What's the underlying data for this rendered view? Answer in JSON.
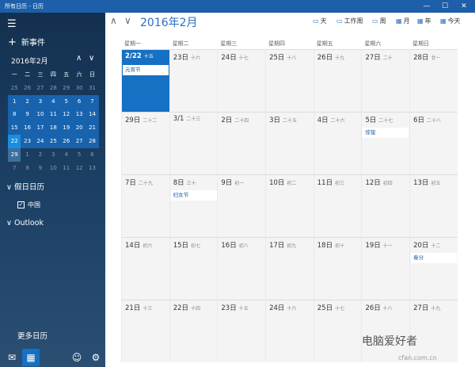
{
  "window": {
    "title": "所有日历 - 日历",
    "controls": [
      "—",
      "☐",
      "✕"
    ]
  },
  "sidebar": {
    "menu_icon": "☰",
    "new_event": "新事件",
    "mini_month": "2016年2月",
    "weekdays": [
      "一",
      "二",
      "三",
      "四",
      "五",
      "六",
      "日"
    ],
    "weeks": [
      [
        {
          "d": "25",
          "t": "o"
        },
        {
          "d": "26",
          "t": "o"
        },
        {
          "d": "27",
          "t": "o"
        },
        {
          "d": "28",
          "t": "o"
        },
        {
          "d": "29",
          "t": "o"
        },
        {
          "d": "30",
          "t": "o"
        },
        {
          "d": "31",
          "t": "o"
        }
      ],
      [
        {
          "d": "1",
          "t": "c"
        },
        {
          "d": "2",
          "t": "c"
        },
        {
          "d": "3",
          "t": "c"
        },
        {
          "d": "4",
          "t": "c"
        },
        {
          "d": "5",
          "t": "c"
        },
        {
          "d": "6",
          "t": "c"
        },
        {
          "d": "7",
          "t": "c"
        }
      ],
      [
        {
          "d": "8",
          "t": "c"
        },
        {
          "d": "9",
          "t": "c"
        },
        {
          "d": "10",
          "t": "c"
        },
        {
          "d": "11",
          "t": "c"
        },
        {
          "d": "12",
          "t": "c"
        },
        {
          "d": "13",
          "t": "c"
        },
        {
          "d": "14",
          "t": "c"
        }
      ],
      [
        {
          "d": "15",
          "t": "c"
        },
        {
          "d": "16",
          "t": "c"
        },
        {
          "d": "17",
          "t": "c"
        },
        {
          "d": "18",
          "t": "c"
        },
        {
          "d": "19",
          "t": "c"
        },
        {
          "d": "20",
          "t": "c"
        },
        {
          "d": "21",
          "t": "c"
        }
      ],
      [
        {
          "d": "22",
          "t": "today"
        },
        {
          "d": "23",
          "t": "c"
        },
        {
          "d": "24",
          "t": "c"
        },
        {
          "d": "25",
          "t": "c"
        },
        {
          "d": "26",
          "t": "c"
        },
        {
          "d": "27",
          "t": "c"
        },
        {
          "d": "28",
          "t": "c"
        }
      ],
      [
        {
          "d": "29",
          "t": "sel"
        },
        {
          "d": "1",
          "t": "o"
        },
        {
          "d": "2",
          "t": "o"
        },
        {
          "d": "3",
          "t": "o"
        },
        {
          "d": "4",
          "t": "o"
        },
        {
          "d": "5",
          "t": "o"
        },
        {
          "d": "6",
          "t": "o"
        }
      ],
      [
        {
          "d": "7",
          "t": "o"
        },
        {
          "d": "8",
          "t": "o"
        },
        {
          "d": "9",
          "t": "o"
        },
        {
          "d": "10",
          "t": "o"
        },
        {
          "d": "11",
          "t": "o"
        },
        {
          "d": "12",
          "t": "o"
        },
        {
          "d": "13",
          "t": "o"
        }
      ]
    ],
    "holiday_section": "假日日历",
    "holiday_item": "中国",
    "outlook_section": "Outlook",
    "more_calendars": "更多日历"
  },
  "toolbar": {
    "title": "2016年2月",
    "views": [
      {
        "icon": "▭",
        "label": "天"
      },
      {
        "icon": "▭",
        "label": "工作周"
      },
      {
        "icon": "▭",
        "label": "周"
      },
      {
        "icon": "▦",
        "label": "月"
      },
      {
        "icon": "▦",
        "label": "年"
      },
      {
        "icon": "▦",
        "label": "今天"
      }
    ]
  },
  "calendar": {
    "day_headers": [
      "星期一",
      "星期二",
      "星期三",
      "星期四",
      "星期五",
      "星期六",
      "星期日"
    ],
    "weeks": [
      [
        {
          "date": "2/22",
          "lunar": "十五",
          "event": "元宵节",
          "selected": true
        },
        {
          "date": "23日",
          "lunar": "十六"
        },
        {
          "date": "24日",
          "lunar": "十七"
        },
        {
          "date": "25日",
          "lunar": "十八"
        },
        {
          "date": "26日",
          "lunar": "十九"
        },
        {
          "date": "27日",
          "lunar": "二十"
        },
        {
          "date": "28日",
          "lunar": "廿一"
        }
      ],
      [
        {
          "date": "29日",
          "lunar": "二十二"
        },
        {
          "date": "3/1",
          "lunar": "二十三"
        },
        {
          "date": "2日",
          "lunar": "二十四"
        },
        {
          "date": "3日",
          "lunar": "二十五"
        },
        {
          "date": "4日",
          "lunar": "二十六"
        },
        {
          "date": "5日",
          "lunar": "二十七",
          "event": "惊蛰"
        },
        {
          "date": "6日",
          "lunar": "二十八"
        }
      ],
      [
        {
          "date": "7日",
          "lunar": "二十九"
        },
        {
          "date": "8日",
          "lunar": "三十",
          "event": "妇女节"
        },
        {
          "date": "9日",
          "lunar": "初一"
        },
        {
          "date": "10日",
          "lunar": "初二"
        },
        {
          "date": "11日",
          "lunar": "初三"
        },
        {
          "date": "12日",
          "lunar": "初四"
        },
        {
          "date": "13日",
          "lunar": "初五"
        }
      ],
      [
        {
          "date": "14日",
          "lunar": "初六"
        },
        {
          "date": "15日",
          "lunar": "初七"
        },
        {
          "date": "16日",
          "lunar": "初八"
        },
        {
          "date": "17日",
          "lunar": "初九"
        },
        {
          "date": "18日",
          "lunar": "初十"
        },
        {
          "date": "19日",
          "lunar": "十一"
        },
        {
          "date": "20日",
          "lunar": "十二",
          "event": "春分"
        }
      ],
      [
        {
          "date": "21日",
          "lunar": "十三"
        },
        {
          "date": "22日",
          "lunar": "十四"
        },
        {
          "date": "23日",
          "lunar": "十五"
        },
        {
          "date": "24日",
          "lunar": "十六"
        },
        {
          "date": "25日",
          "lunar": "十七"
        },
        {
          "date": "26日",
          "lunar": "十八"
        },
        {
          "date": "27日",
          "lunar": "十九"
        }
      ]
    ]
  },
  "watermark": {
    "text": "电脑爱好者",
    "sub": "cfan.com.cn"
  },
  "colors": {
    "accent": "#1670c3",
    "titlebar": "#1d5fa8",
    "today": "#1a8ee0"
  }
}
